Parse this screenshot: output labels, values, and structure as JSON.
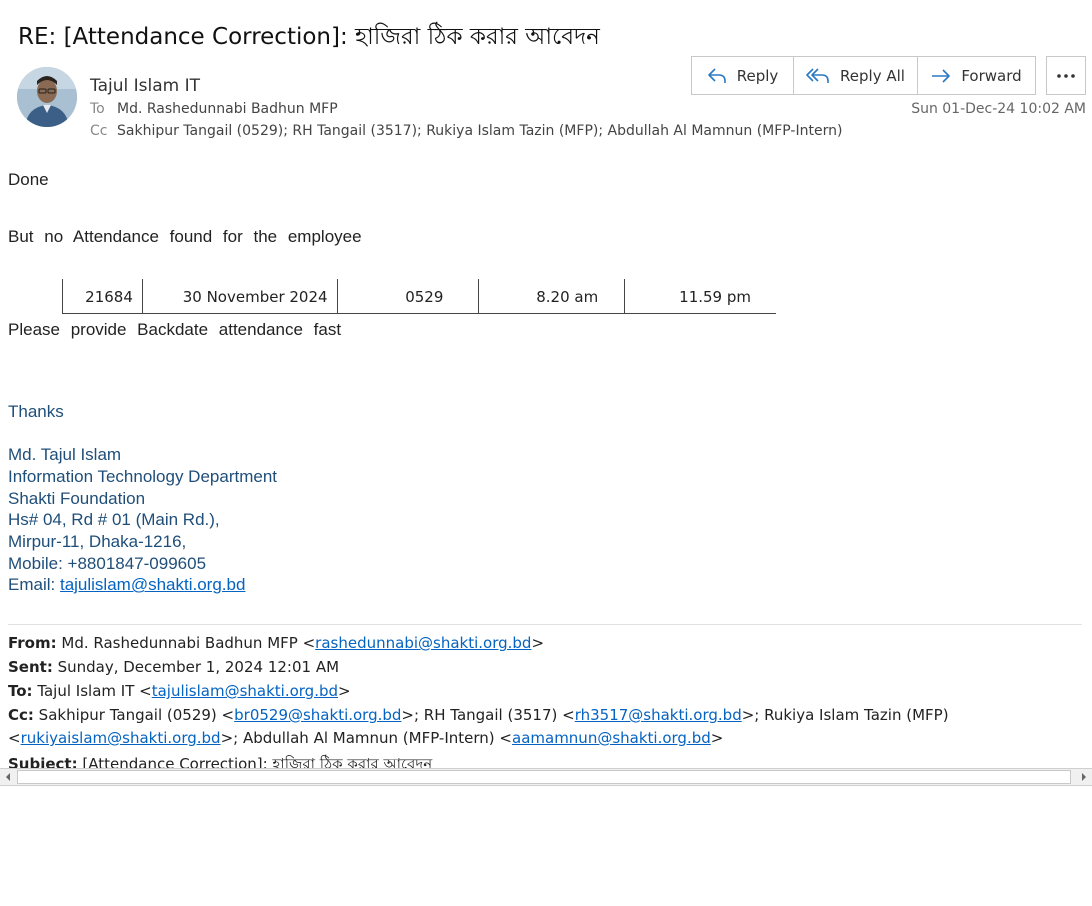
{
  "email": {
    "subject": "RE: [Attendance Correction]: হাজিরা ঠিক করার আবেদন",
    "sender_name": "Tajul Islam IT",
    "to_label": "To",
    "to": "Md. Rashedunnabi Badhun MFP",
    "cc_label": "Cc",
    "cc": "Sakhipur Tangail (0529); RH Tangail (3517); Rukiya Islam Tazin (MFP); Abdullah Al Mamnun (MFP-Intern)",
    "date": "Sun 01-Dec-24 10:02 AM"
  },
  "actions": {
    "reply": "Reply",
    "reply_all": "Reply All",
    "forward": "Forward"
  },
  "body": {
    "line1": "Done",
    "line2": "But no Attendance found for the employee",
    "table_row": [
      "21684",
      "30 November 2024",
      "0529",
      "8.20 am",
      "11.59 pm"
    ],
    "line3": "Please provide Backdate attendance fast"
  },
  "signature": {
    "thanks": "Thanks",
    "name": "Md. Tajul Islam",
    "dept": "Information Technology Department",
    "org": "Shakti Foundation",
    "addr1": "Hs# 04, Rd # 01 (Main Rd.),",
    "addr2": "Mirpur-11, Dhaka-1216,",
    "mobile": "Mobile: +8801847-099605",
    "email_label": "Email: ",
    "email": "tajulislam@shakti.org.bd"
  },
  "quoted": {
    "from_label": "From:",
    "from_name": " Md. Rashedunnabi Badhun MFP <",
    "from_email": "rashedunnabi@shakti.org.bd",
    "sent_label": "Sent:",
    "sent": " Sunday, December 1, 2024 12:01 AM",
    "to_label": "To:",
    "to_name": " Tajul Islam IT <",
    "to_email": "tajulislam@shakti.org.bd",
    "cc_label": "Cc:",
    "cc_part1": " Sakhipur Tangail (0529) <",
    "cc_email1": "br0529@shakti.org.bd",
    "cc_part2": ">; RH Tangail (3517) <",
    "cc_email2": "rh3517@shakti.org.bd",
    "cc_part3": ">; Rukiya Islam Tazin (MFP)",
    "cc_part4": "<",
    "cc_email3": "rukiyaislam@shakti.org.bd",
    "cc_part5": ">; Abdullah Al Mamnun (MFP-Intern) <",
    "cc_email4": "aamamnun@shakti.org.bd",
    "close": ">",
    "subject_label": "Subject:",
    "subject": " [Attendance Correction]: হাজিরা ঠিক করার আবেদন"
  },
  "icons": {
    "reply": "reply-arrow-icon",
    "reply_all": "reply-all-arrow-icon",
    "forward": "forward-arrow-icon",
    "more": "more-horizontal-icon"
  },
  "colors": {
    "signature": "#1f4e79",
    "link": "#0563c1",
    "icon_accent": "#2b79c2"
  }
}
